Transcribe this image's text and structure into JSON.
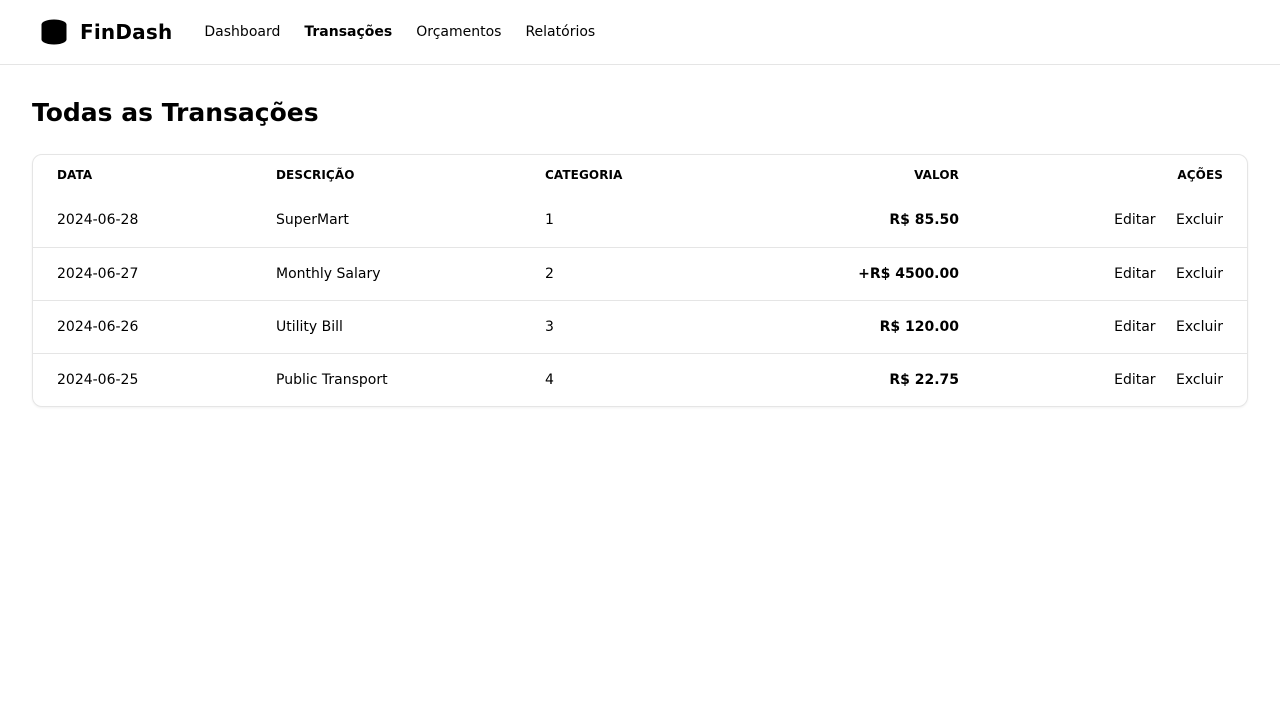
{
  "brand": {
    "name": "FinDash",
    "icon": "stack-logo-icon"
  },
  "nav": {
    "items": [
      {
        "label": "Dashboard",
        "active": false
      },
      {
        "label": "Transações",
        "active": true
      },
      {
        "label": "Orçamentos",
        "active": false
      },
      {
        "label": "Relatórios",
        "active": false
      }
    ]
  },
  "page": {
    "title": "Todas as Transações"
  },
  "table": {
    "headers": {
      "date": "DATA",
      "description": "DESCRIÇÃO",
      "category": "CATEGORIA",
      "value": "VALOR",
      "actions": "AÇÕES"
    },
    "rows": [
      {
        "date": "2024-06-28",
        "description": "SuperMart",
        "category": "1",
        "value": "R$ 85.50",
        "edit": "Editar",
        "delete": "Excluir"
      },
      {
        "date": "2024-06-27",
        "description": "Monthly Salary",
        "category": "2",
        "value": "+R$ 4500.00",
        "edit": "Editar",
        "delete": "Excluir"
      },
      {
        "date": "2024-06-26",
        "description": "Utility Bill",
        "category": "3",
        "value": "R$ 120.00",
        "edit": "Editar",
        "delete": "Excluir"
      },
      {
        "date": "2024-06-25",
        "description": "Public Transport",
        "category": "4",
        "value": "R$ 22.75",
        "edit": "Editar",
        "delete": "Excluir"
      }
    ]
  },
  "colors": {
    "text": "#000000",
    "border": "#e5e5e5",
    "background": "#ffffff"
  }
}
